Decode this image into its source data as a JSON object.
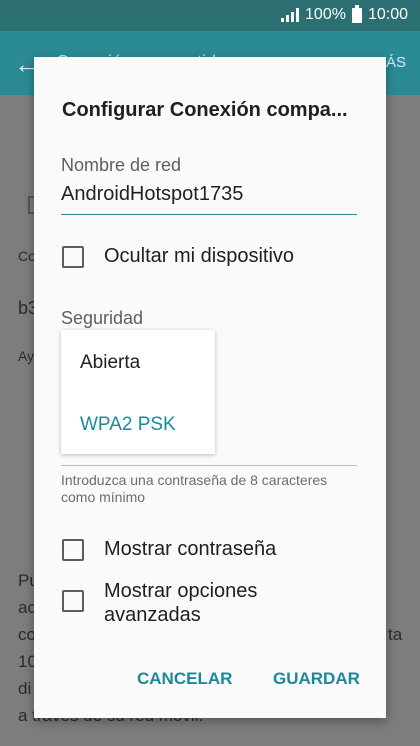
{
  "status": {
    "battery": "100%",
    "time": "10:00"
  },
  "appbar": {
    "title": "Conexión compartida",
    "more": "MÁS"
  },
  "background": {
    "row_b": "b3",
    "row_co": "Co",
    "row_ay": "Ay",
    "lines": [
      "Pu",
      "ac",
      "co",
      "10",
      "di",
      "a través de su red móvil."
    ],
    "right_partial": "ta"
  },
  "dialog": {
    "title": "Configurar Conexión compa...",
    "network_label": "Nombre de red",
    "network_value": "AndroidHotspot1735",
    "hide_device": "Ocultar mi dispositivo",
    "security_label": "Seguridad",
    "security_options": [
      "Abierta",
      "WPA2 PSK"
    ],
    "hint": "Introduzca una contraseña de 8 caracteres como mínimo",
    "show_password": "Mostrar contraseña",
    "show_advanced": "Mostrar opciones avanzadas",
    "cancel": "CANCELAR",
    "save": "GUARDAR"
  },
  "colors": {
    "accent": "#2b8b95",
    "button": "#1a8a9a"
  }
}
